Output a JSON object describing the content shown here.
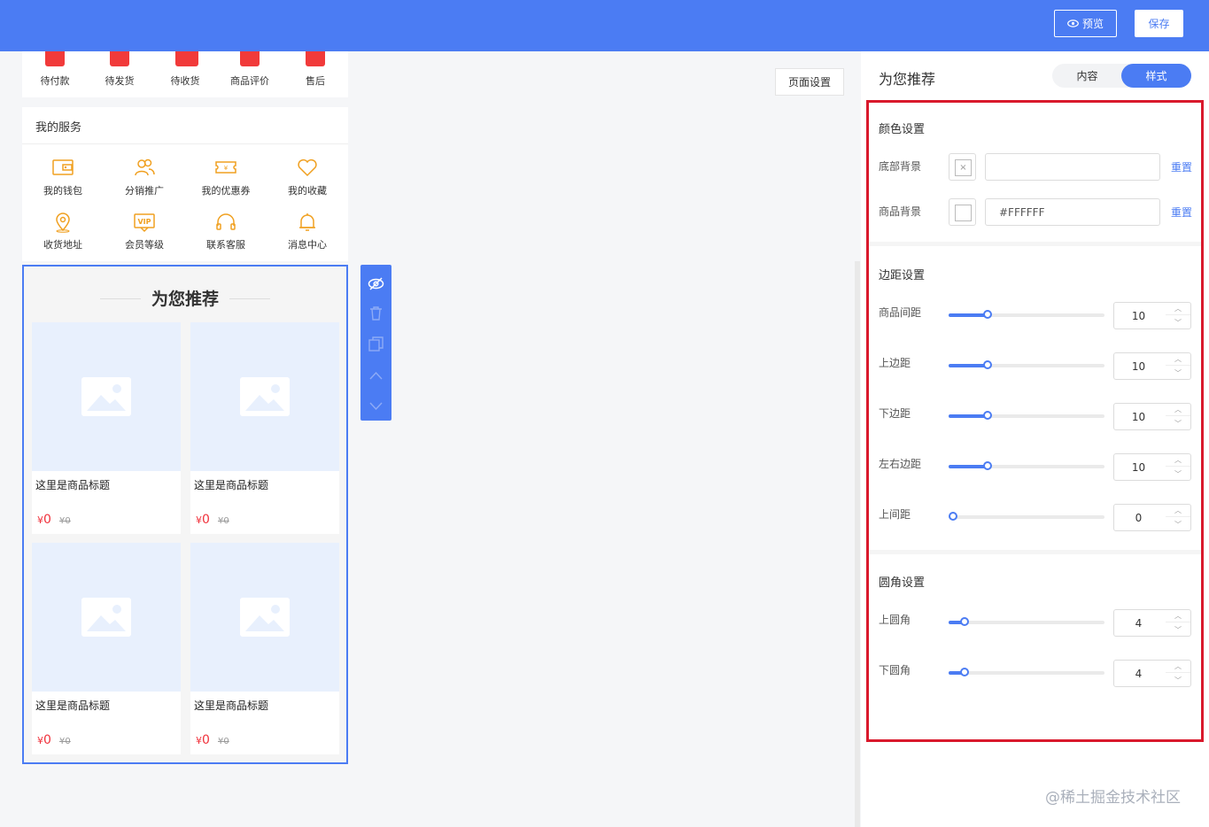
{
  "header": {
    "preview_label": "预览",
    "save_label": "保存"
  },
  "orders": [
    {
      "label": "待付款"
    },
    {
      "label": "待发货"
    },
    {
      "label": "待收货"
    },
    {
      "label": "商品评价"
    },
    {
      "label": "售后"
    }
  ],
  "services": {
    "title": "我的服务",
    "items": [
      {
        "label": "我的钱包",
        "icon": "wallet-icon"
      },
      {
        "label": "分销推广",
        "icon": "users-icon"
      },
      {
        "label": "我的优惠券",
        "icon": "coupon-icon"
      },
      {
        "label": "我的收藏",
        "icon": "heart-icon"
      },
      {
        "label": "收货地址",
        "icon": "location-icon"
      },
      {
        "label": "会员等级",
        "icon": "vip-icon"
      },
      {
        "label": "联系客服",
        "icon": "headset-icon"
      },
      {
        "label": "消息中心",
        "icon": "bell-icon"
      }
    ]
  },
  "recommend": {
    "title": "为您推荐",
    "products": [
      {
        "title": "这里是商品标题",
        "currency": "¥",
        "price": "0",
        "orig_price": "¥0"
      },
      {
        "title": "这里是商品标题",
        "currency": "¥",
        "price": "0",
        "orig_price": "¥0"
      },
      {
        "title": "这里是商品标题",
        "currency": "¥",
        "price": "0",
        "orig_price": "¥0"
      },
      {
        "title": "这里是商品标题",
        "currency": "¥",
        "price": "0",
        "orig_price": "¥0"
      }
    ]
  },
  "canvas": {
    "page_settings_label": "页面设置"
  },
  "panel": {
    "title": "为您推荐",
    "tabs": [
      {
        "label": "内容"
      },
      {
        "label": "样式"
      }
    ],
    "active_tab": "样式",
    "color": {
      "title": "颜色设置",
      "rows": [
        {
          "label": "底部背景",
          "value": "",
          "reset": "重置"
        },
        {
          "label": "商品背景",
          "value": "#FFFFFF",
          "reset": "重置"
        }
      ]
    },
    "spacing": {
      "title": "边距设置",
      "rows": [
        {
          "label": "商品间距",
          "value": "10",
          "fraction": 0.25
        },
        {
          "label": "上边距",
          "value": "10",
          "fraction": 0.25
        },
        {
          "label": "下边距",
          "value": "10",
          "fraction": 0.25
        },
        {
          "label": "左右边距",
          "value": "10",
          "fraction": 0.25
        },
        {
          "label": "上间距",
          "value": "0",
          "fraction": 0
        }
      ]
    },
    "radius": {
      "title": "圆角设置",
      "rows": [
        {
          "label": "上圆角",
          "value": "4",
          "fraction": 0.1
        },
        {
          "label": "下圆角",
          "value": "4",
          "fraction": 0.1
        }
      ]
    }
  },
  "colors": {
    "accent": "#4b7cf3",
    "price": "#f0323c",
    "highlight_box": "#d9192c",
    "order_icon": "#f13a3a",
    "service_icon": "#f0a020"
  },
  "watermark": "@稀土掘金技术社区"
}
